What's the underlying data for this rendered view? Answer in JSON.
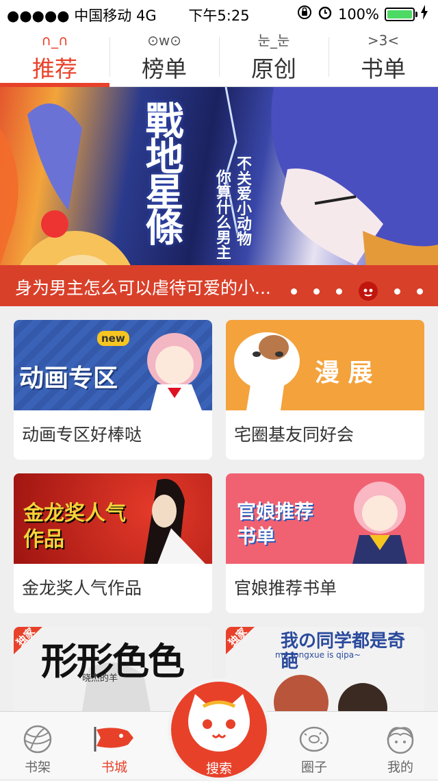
{
  "status_bar": {
    "carrier": "●●●●● 中国移动  4G",
    "time": "下午5:25",
    "battery": "100%",
    "battery_level": 1.0
  },
  "tabs": [
    {
      "emoticon": "∩_∩",
      "label": "推荐",
      "active": true
    },
    {
      "emoticon": "⊙w⊙",
      "label": "榜单",
      "active": false
    },
    {
      "emoticon": "눈_눈",
      "label": "原创",
      "active": false
    },
    {
      "emoticon": ">3<",
      "label": "书单",
      "active": false
    }
  ],
  "banner": {
    "title_art": "戰地星條",
    "subtitle_1": "不关爱小动物",
    "subtitle_2": "你算什么男主",
    "caption": "身为男主怎么可以虐待可爱的小...",
    "page_count": 6,
    "current_page": 4
  },
  "cards": [
    {
      "art_text": "动画专区",
      "art_badge": "new",
      "name": "动画专区好棒哒",
      "color": "#3a63b8"
    },
    {
      "art_text": "漫  展",
      "name": "宅圈基友同好会",
      "color": "#f4a23c"
    },
    {
      "art_text": "金龙奖人气作品",
      "name": "金龙奖人气作品",
      "color": "#c41a14"
    },
    {
      "art_text": "官娘推荐书单",
      "name": "官娘推荐书单",
      "color": "#f06272"
    },
    {
      "art_text": "形形色色",
      "art_badge": "独家",
      "art_sub": "晓杰的羊",
      "color": "#1a1a1a"
    },
    {
      "art_text": "我の同学都是奇葩",
      "art_badge": "独家",
      "art_sub": "my tongxue is qipa~",
      "color": "#f2f2f2"
    }
  ],
  "bottom_nav": {
    "bookshelf": "书架",
    "bookstore": "书城",
    "search": "搜索",
    "circle": "圈子",
    "mine": "我的"
  },
  "colors": {
    "accent": "#e8412a"
  }
}
